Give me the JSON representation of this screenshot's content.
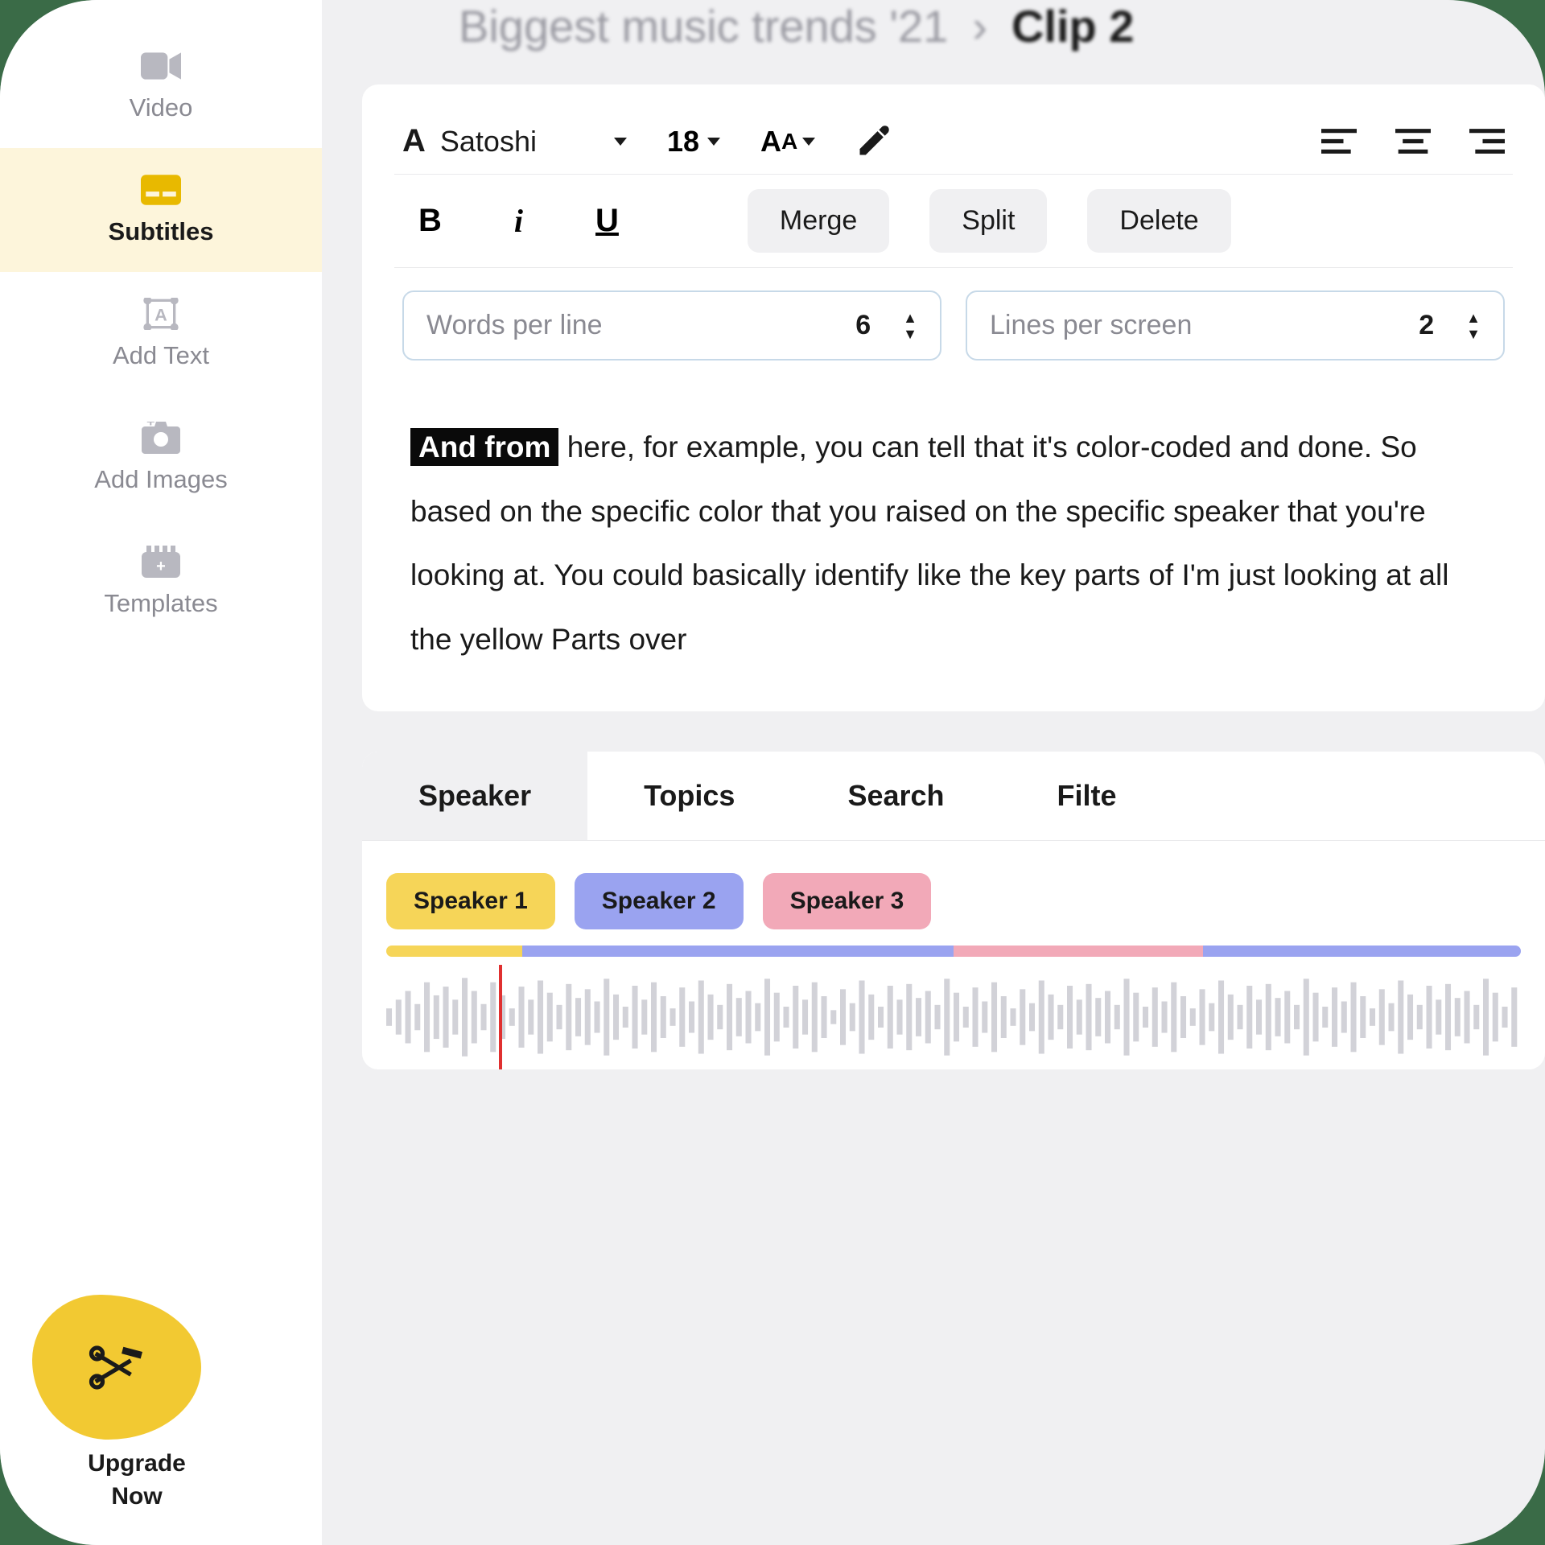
{
  "breadcrumb": {
    "project": "Biggest music trends '21",
    "sep": "›",
    "current": "Clip 2"
  },
  "sidebar": {
    "items": [
      {
        "label": "Video"
      },
      {
        "label": "Subtitles"
      },
      {
        "label": "Add Text"
      },
      {
        "label": "Add Images"
      },
      {
        "label": "Templates"
      }
    ],
    "upgrade": {
      "line1": "Upgrade",
      "line2": "Now"
    }
  },
  "toolbar": {
    "font_name": "Satoshi",
    "font_size": "18",
    "merge": "Merge",
    "split": "Split",
    "delete": "Delete"
  },
  "steppers": {
    "words_label": "Words per line",
    "words_value": "6",
    "lines_label": "Lines per screen",
    "lines_value": "2"
  },
  "transcript": {
    "highlight": "And from",
    "rest": " here, for example, you can tell that it's color-coded and done. So based on the specific color that you raised on the specific speaker that you're looking at. You could basically identify like the key parts of I'm just looking at all the yellow Parts over"
  },
  "tabs": [
    "Speaker",
    "Topics",
    "Search",
    "Filte"
  ],
  "speakers": [
    "Speaker 1",
    "Speaker 2",
    "Speaker 3"
  ]
}
